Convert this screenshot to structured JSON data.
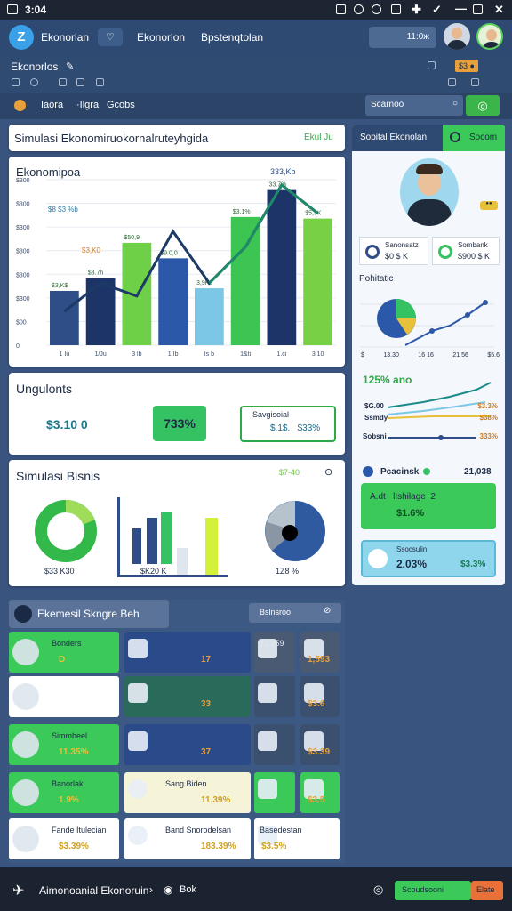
{
  "status": {
    "time": "3:04"
  },
  "appbar": {
    "title": "Ekonorlan",
    "chip": "♡",
    "links": [
      "Ekonorlon",
      "Bpstenqtolan"
    ],
    "search_value": "11:0ж"
  },
  "subbar": {
    "title": "Ekonorlos",
    "chev": "✎",
    "badge": "$3 ●"
  },
  "filterbar": {
    "items": [
      "Iaora",
      "·Ilgra",
      "Gcobs"
    ],
    "search_placeholder": "Scarnoo"
  },
  "header_card": {
    "title": "Simulasi Ekonomiruokornalruteyhgida",
    "tag": "Ekul Ju"
  },
  "chart_card": {
    "title": "Ekonomipoa",
    "top_label": "333,Kb"
  },
  "chart_data": {
    "type": "bar",
    "title": "Ekonomipoa",
    "categories": [
      "1 Iu",
      "1/Ju",
      "3 lb",
      "1 Ib",
      "Is b",
      "1&ti",
      "1.ci",
      "3 10"
    ],
    "yticks": [
      "$300",
      "$300",
      "$300",
      "$300",
      "$300",
      "$300",
      "$00",
      "0"
    ],
    "values": [
      1.05,
      1.3,
      1.98,
      1.68,
      1.1,
      2.48,
      3.0,
      2.45
    ],
    "line": [
      0.65,
      1.2,
      0.95,
      2.2,
      1.2,
      1.9,
      3.1,
      2.55
    ],
    "colors": [
      "#2f4d86",
      "#1d3468",
      "#6ed046",
      "#2b58a8",
      "#7cc6e6",
      "#3cc552",
      "#1d3468",
      "#78d145"
    ],
    "data_labels": [
      "$3,K$",
      "$3.7h",
      "$50,9",
      "$9.0,0",
      "3,9K0",
      "$3.1%",
      "33.7%",
      "$5,9K"
    ],
    "annot": [
      "$8 $3 %b",
      "$3,K0"
    ]
  },
  "summary": {
    "title": "Ungulonts",
    "value1": "$3.10 0",
    "value2": "733%",
    "box_title": "Savgisoial",
    "box_value": "$,1$.   $33%"
  },
  "sim": {
    "title": "Simulasi Bisnis",
    "tag": "$7-40",
    "cap1": "$33 K30",
    "cap2": "$K20 K",
    "cap3": "1Z8 %"
  },
  "sidebar": {
    "tab1": "Sopital Ekonolan",
    "tab2": "Socom",
    "chip": "●●",
    "stat1_label": "Sanonsatz",
    "stat1_value": "$0 $ K",
    "stat2_label": "Sombank",
    "stat2_value": "$900 $ K",
    "chart_title": "Pohitatic",
    "xt": [
      "$",
      "13.30",
      "16 16",
      "21 56",
      "$5.6"
    ],
    "trend_label": "125% ano",
    "rows": [
      [
        "$G.00",
        "",
        "$3.3%"
      ],
      [
        "Ssmdy",
        "",
        "$38%"
      ],
      [
        "Sobsni",
        "",
        "333%"
      ]
    ],
    "item_label": "Pcacinsk",
    "item_value": "21,038",
    "cta_title": "A.dt   lIshilage  2",
    "cta_value": "$1.6%",
    "info_title": "Ssocsulin",
    "info_value": "2.03%",
    "info_side": "$3.3%"
  },
  "grid": {
    "header": "Ekemesil Skngre Beh",
    "search": "Bslnsroo",
    "tiles": [
      {
        "t": "Bonders",
        "v": "D"
      },
      {
        "t": "",
        "v": "17"
      },
      {
        "t": "$3,359",
        "v": ""
      },
      {
        "t": "",
        "v": "1,593"
      },
      {
        "t": "",
        "v": ""
      },
      {
        "t": "",
        "v": "33"
      },
      {
        "t": "",
        "v": "",
        "i": ""
      },
      {
        "t": "",
        "v": "$3.6"
      },
      {
        "t": "Simmheel",
        "v": "11.35%"
      },
      {
        "t": "",
        "v": "37"
      },
      {
        "t": "",
        "v": ""
      },
      {
        "t": "",
        "v": "$3.39"
      },
      {
        "t": "Banorlak",
        "v": "1.9%"
      },
      {
        "t": "Sang Biden",
        "v": "11.39%"
      },
      {
        "t": "",
        "v": ""
      },
      {
        "t": "",
        "v": "$3.5"
      },
      {
        "t": "Fande   Itulecian",
        "v": "$3.39%"
      },
      {
        "t": "Band Snorodelsan",
        "v": "183.39%"
      },
      {
        "t": "Basedestan",
        "v": "$3.5%"
      }
    ]
  },
  "bottom": {
    "title": "Aimonoanial Ekonoruin",
    "crumb": "Bok",
    "btn1": "Scoudsooni",
    "btn2": "Elate"
  }
}
